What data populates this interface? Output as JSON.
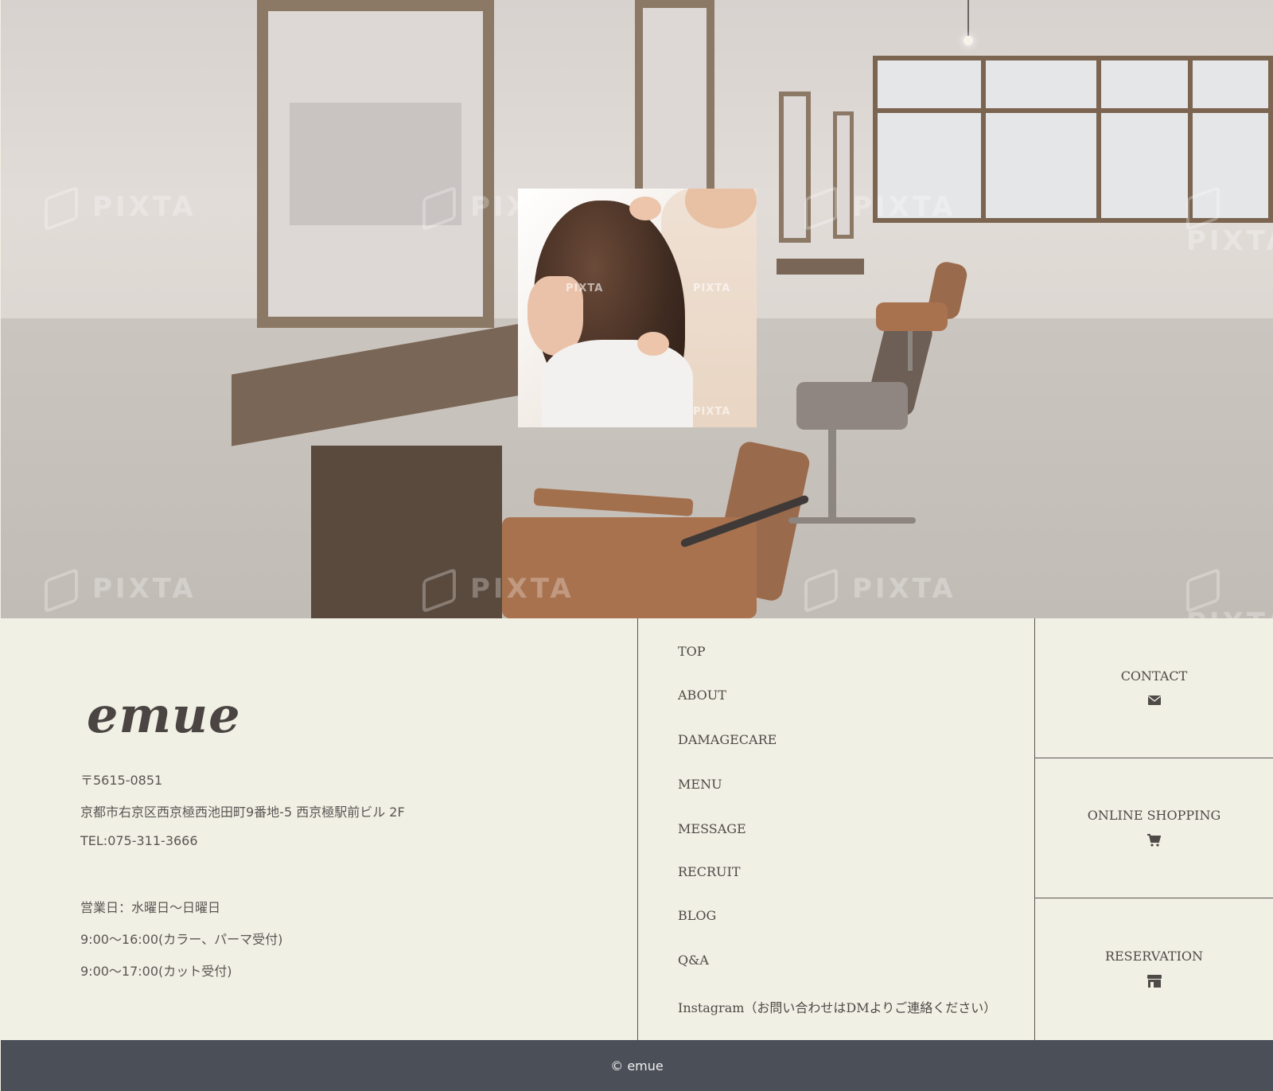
{
  "hero": {
    "watermark_text": "PIXTA",
    "photo_watermark_text": "PIXTA"
  },
  "info": {
    "logo": "emue",
    "postal": "〒5615-0851",
    "address": "京都市右京区西京極西池田町9番地-5 西京極駅前ビル 2F",
    "tel": "TEL:075-311-3666",
    "business_days": "営業日：水曜日～日曜日",
    "hours_color_perm": "9:00～16:00(カラー、パーマ受付)",
    "hours_cut": "9:00～17:00(カット受付)"
  },
  "nav": {
    "items": [
      {
        "label": "TOP"
      },
      {
        "label": "ABOUT"
      },
      {
        "label": "DAMAGECARE"
      },
      {
        "label": "MENU"
      },
      {
        "label": "MESSAGE"
      },
      {
        "label": "RECRUIT"
      },
      {
        "label": "BLOG"
      },
      {
        "label": "Q&A"
      },
      {
        "label": "Instagram（お問い合わせはDMよりご連絡ください）"
      }
    ]
  },
  "side": {
    "contact": {
      "label": "CONTACT",
      "icon": "envelope-icon"
    },
    "shopping": {
      "label": "ONLINE SHOPPING",
      "icon": "cart-icon"
    },
    "reservation": {
      "label": "RESERVATION",
      "icon": "store-icon"
    }
  },
  "footer": {
    "copyright": "© emue"
  },
  "colors": {
    "background": "#f1f0e4",
    "footer_bar": "#4b4f57",
    "text": "#4a4a4a"
  }
}
